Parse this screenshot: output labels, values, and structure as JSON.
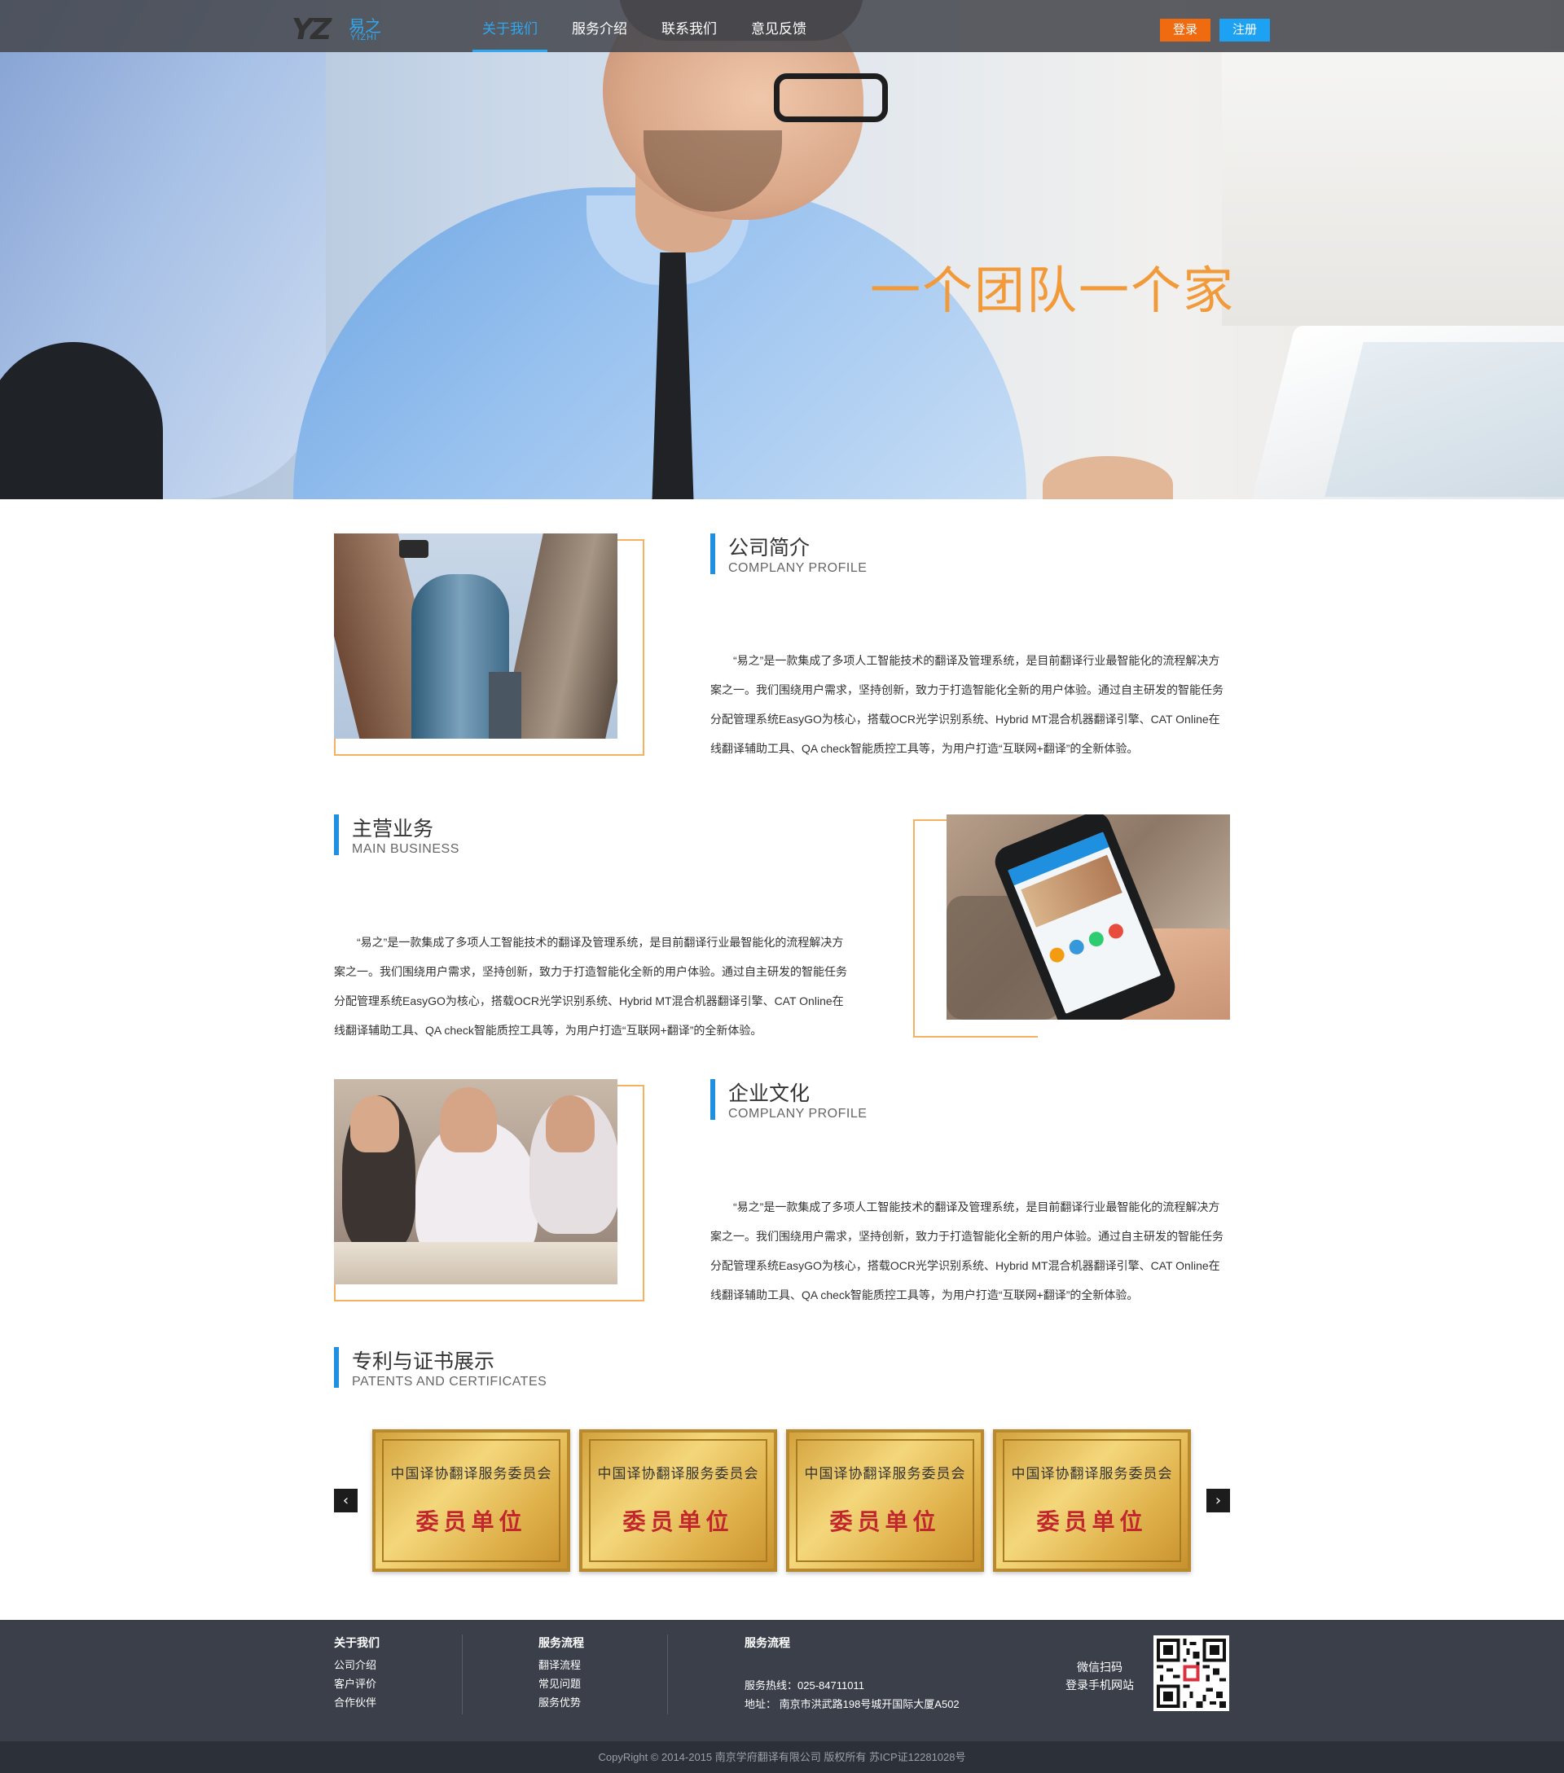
{
  "header": {
    "logo_mark": "YZ",
    "logo_cn": "易之",
    "logo_en": "YIZHI",
    "nav": [
      "关于我们",
      "服务介绍",
      "联系我们",
      "意见反馈"
    ],
    "active_nav": "关于我们",
    "login_label": "登录",
    "register_label": "注册",
    "colors": {
      "accent": "#2fa8ef",
      "login": "#f06a0f",
      "register": "#1da1f2"
    }
  },
  "hero": {
    "slogan": "一个团队一个家",
    "slogan_color": "#f29a3a"
  },
  "sections": {
    "profile": {
      "title_cn": "公司简介",
      "title_en": "COMPLANY  PROFILE",
      "body": "“易之”是一款集成了多项人工智能技术的翻译及管理系统，是目前翻译行业最智能化的流程解决方案之一。我们围绕用户需求，坚持创新，致力于打造智能化全新的用户体验。通过自主研发的智能任务分配管理系统EasyGO为核心，搭载OCR光学识别系统、Hybrid MT混合机器翻译引擎、CAT Online在线翻译辅助工具、QA check智能质控工具等，为用户打造“互联网+翻译”的全新体验。"
    },
    "business": {
      "title_cn": "主营业务",
      "title_en": "MAIN BUSINESS",
      "body": "“易之”是一款集成了多项人工智能技术的翻译及管理系统，是目前翻译行业最智能化的流程解决方案之一。我们围绕用户需求，坚持创新，致力于打造智能化全新的用户体验。通过自主研发的智能任务分配管理系统EasyGO为核心，搭载OCR光学识别系统、Hybrid MT混合机器翻译引擎、CAT Online在线翻译辅助工具、QA check智能质控工具等，为用户打造“互联网+翻译”的全新体验。"
    },
    "culture": {
      "title_cn": "企业文化",
      "title_en": "COMPLANY  PROFILE",
      "body": "“易之”是一款集成了多项人工智能技术的翻译及管理系统，是目前翻译行业最智能化的流程解决方案之一。我们围绕用户需求，坚持创新，致力于打造智能化全新的用户体验。通过自主研发的智能任务分配管理系统EasyGO为核心，搭载OCR光学识别系统、Hybrid MT混合机器翻译引擎、CAT Online在线翻译辅助工具、QA check智能质控工具等，为用户打造“互联网+翻译”的全新体验。"
    },
    "patents": {
      "title_cn": "专利与证书展示",
      "title_en": "PATENTS AND CERTIFICATES",
      "certificates": [
        {
          "title": "中国译协翻译服务委员会",
          "subtitle": "委员单位"
        },
        {
          "title": "中国译协翻译服务委员会",
          "subtitle": "委员单位"
        },
        {
          "title": "中国译协翻译服务委员会",
          "subtitle": "委员单位"
        },
        {
          "title": "中国译协翻译服务委员会",
          "subtitle": "委员单位"
        }
      ],
      "prev_icon": "chevron-left-icon",
      "next_icon": "chevron-right-icon"
    }
  },
  "footer": {
    "about": {
      "head": "关于我们",
      "links": [
        "公司介绍",
        "客户评价",
        "合作伙伴"
      ]
    },
    "process": {
      "head": "服务流程",
      "links": [
        "翻译流程",
        "常见问题",
        "服务优势"
      ]
    },
    "contact": {
      "head": "服务流程",
      "hotline": "服务热线：025-84711011",
      "address": "地址： 南京市洪武路198号城开国际大厦A502"
    },
    "wechat_line1": "微信扫码",
    "wechat_line2": "登录手机网站",
    "qr_icon": "qr-code-icon",
    "copyright": "CopyRight © 2014-2015 南京学府翻译有限公司 版权所有 苏ICP证12281028号"
  }
}
